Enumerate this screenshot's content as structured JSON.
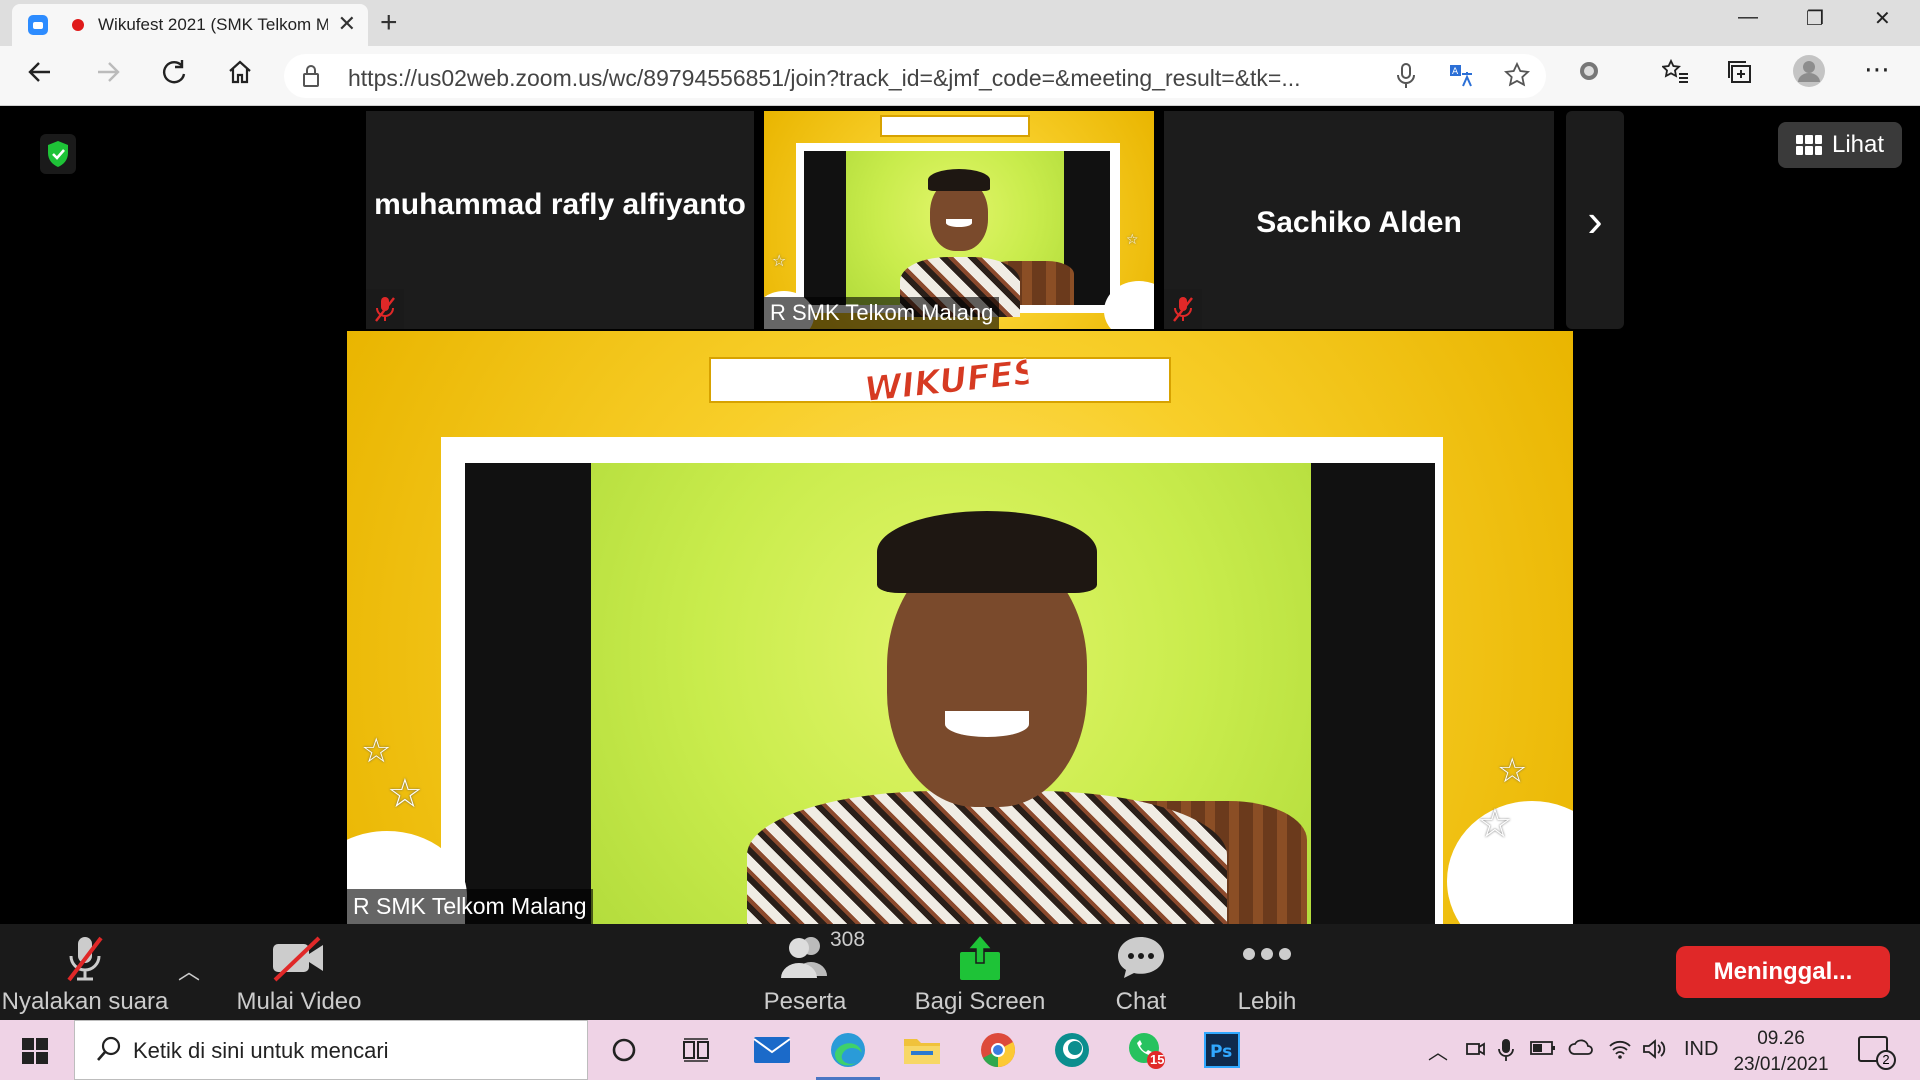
{
  "browser": {
    "tab_title": "Wikufest 2021 (SMK Telkom Malang)",
    "tab_close": "✕",
    "new_tab": "+",
    "url": "https://us02web.zoom.us/wc/89794556851/join?track_id=&jmf_code=&meeting_result=&tk=...",
    "window_controls": {
      "minimize": "—",
      "restore": "❐",
      "close": "✕"
    }
  },
  "meeting": {
    "view_button": "Lihat",
    "participants_strip": [
      {
        "name": "muhammad rafly alfiyanto",
        "muted": true,
        "video": false
      },
      {
        "name": "R SMK Telkom Malang",
        "muted": false,
        "video": true
      },
      {
        "name": "Sachiko Alden",
        "muted": true,
        "video": false
      }
    ],
    "next_arrow": "›",
    "speaker_label": "R SMK Telkom Malang",
    "colors": {
      "shield": "#1ec337",
      "leave": "#e02828",
      "share": "#1ec337"
    }
  },
  "toolbar": {
    "audio_label": "Nyalakan suara",
    "video_label": "Mulai Video",
    "participants_label": "Peserta",
    "participants_count": "308",
    "share_label": "Bagi Screen",
    "chat_label": "Chat",
    "more_label": "Lebih",
    "leave_label": "Meninggal..."
  },
  "taskbar": {
    "search_placeholder": "Ketik di sini untuk mencari",
    "whatsapp_badge": "15",
    "language": "IND",
    "time": "09.26",
    "date": "23/01/2021",
    "notification_count": "2"
  }
}
